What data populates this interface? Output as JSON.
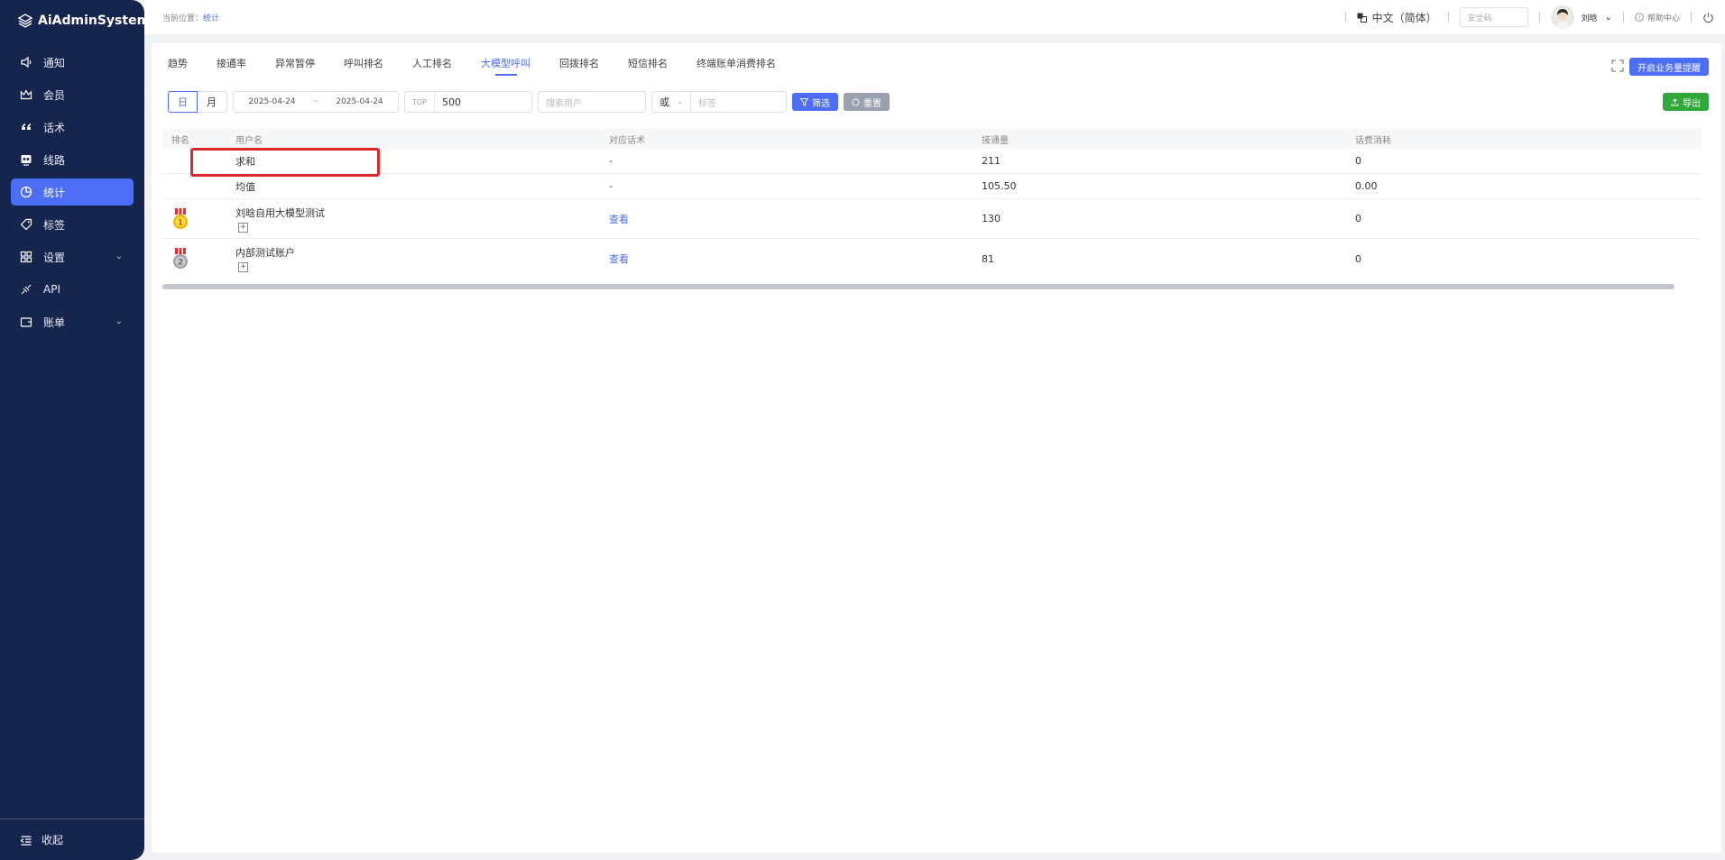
{
  "app": {
    "title": "AiAdminSystem"
  },
  "sidebar": {
    "items": [
      {
        "label": "通知",
        "icon": "speaker-icon"
      },
      {
        "label": "会员",
        "icon": "crown-icon"
      },
      {
        "label": "话术",
        "icon": "quote-icon"
      },
      {
        "label": "线路",
        "icon": "route-icon"
      },
      {
        "label": "统计",
        "icon": "pie-chart-icon",
        "active": true
      },
      {
        "label": "标签",
        "icon": "tag-icon"
      },
      {
        "label": "设置",
        "icon": "grid-icon",
        "expandable": true
      },
      {
        "label": "API",
        "icon": "api-icon"
      },
      {
        "label": "账单",
        "icon": "wallet-icon",
        "expandable": true
      }
    ],
    "collapse_label": "收起"
  },
  "header": {
    "breadcrumb_prefix": "当前位置：",
    "breadcrumb_current": "统计",
    "language": "中文（简体）",
    "security_placeholder": "安全码",
    "username": "刘晗",
    "help": "帮助中心"
  },
  "tabs": [
    "趋势",
    "接通率",
    "异常暂停",
    "呼叫排名",
    "人工排名",
    "大模型呼叫",
    "回拨排名",
    "短信排名",
    "终端账单消费排名"
  ],
  "active_tab": "大模型呼叫",
  "toolbar": {
    "business_alert_button": "开启业务量提醒",
    "export_button": "导出"
  },
  "filters": {
    "period_day": "日",
    "period_month": "月",
    "start_date": "2025-04-24",
    "date_separator": "~",
    "end_date": "2025-04-24",
    "top_prefix": "TOP",
    "top_value": "500",
    "search_user_placeholder": "搜索用户",
    "logic_select": "或",
    "tag_placeholder": "标签",
    "filter_button": "筛选",
    "reset_button": "重置"
  },
  "table": {
    "headers": [
      "排名",
      "用户名",
      "对应话术",
      "接通量",
      "话费消耗"
    ],
    "summary_rows": [
      {
        "name": "求和",
        "script": "-",
        "connected": "211",
        "cost": "0"
      },
      {
        "name": "均值",
        "script": "-",
        "connected": "105.50",
        "cost": "0.00"
      }
    ],
    "rows": [
      {
        "rank": 1,
        "name": "刘晗自用大模型测试",
        "script": "查看",
        "connected": "130",
        "cost": "0"
      },
      {
        "rank": 2,
        "name": "内部测试账户",
        "script": "查看",
        "connected": "81",
        "cost": "0"
      }
    ],
    "expand_glyph": "+"
  },
  "colors": {
    "sidebar_bg": "#16254e",
    "accent": "#4c6ef5",
    "export": "#31a83a",
    "highlight": "#e0252c"
  }
}
